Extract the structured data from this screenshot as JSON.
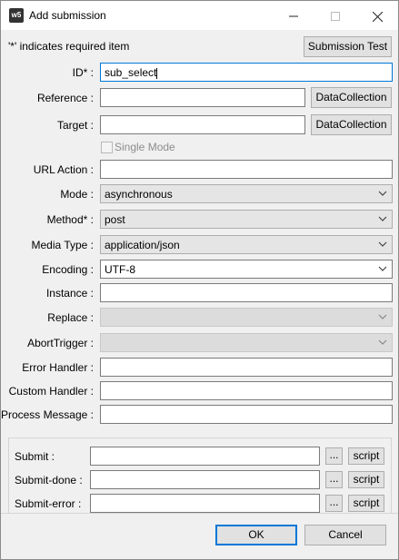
{
  "window": {
    "title": "Add submission",
    "icon_label": "w5",
    "icon_sup": "5"
  },
  "note": "'*' indicates required item",
  "submission_test_label": "Submission Test",
  "rows": {
    "id": {
      "label": "ID* :",
      "value": "sub_select"
    },
    "reference": {
      "label": "Reference :",
      "value": "",
      "button": "DataCollection"
    },
    "target": {
      "label": "Target :",
      "value": "",
      "button": "DataCollection"
    },
    "single_mode": {
      "label": "Single Mode",
      "checked": false
    },
    "url_action": {
      "label": "URL Action :",
      "value": ""
    },
    "mode": {
      "label": "Mode :",
      "value": "asynchronous"
    },
    "method": {
      "label": "Method* :",
      "value": "post"
    },
    "media_type": {
      "label": "Media Type :",
      "value": "application/json"
    },
    "encoding": {
      "label": "Encoding :",
      "value": "UTF-8"
    },
    "instance": {
      "label": "Instance :",
      "value": ""
    },
    "replace": {
      "label": "Replace :",
      "value": ""
    },
    "abort_trigger": {
      "label": "AbortTrigger :",
      "value": ""
    },
    "error_handler": {
      "label": "Error Handler :",
      "value": ""
    },
    "custom_handler": {
      "label": "Custom Handler :",
      "value": ""
    },
    "process_message": {
      "label": "Process Message :",
      "value": ""
    }
  },
  "scripts": {
    "submit": {
      "label": "Submit :",
      "value": "",
      "browse": "...",
      "script": "script"
    },
    "submit_done": {
      "label": "Submit-done :",
      "value": "",
      "browse": "...",
      "script": "script"
    },
    "submit_error": {
      "label": "Submit-error :",
      "value": "",
      "browse": "...",
      "script": "script"
    }
  },
  "footer": {
    "ok": "OK",
    "cancel": "Cancel"
  },
  "icons": {
    "minimize": "minimize-icon",
    "maximize": "maximize-icon",
    "close": "close-icon",
    "dropdown": "chevron-down-icon"
  }
}
